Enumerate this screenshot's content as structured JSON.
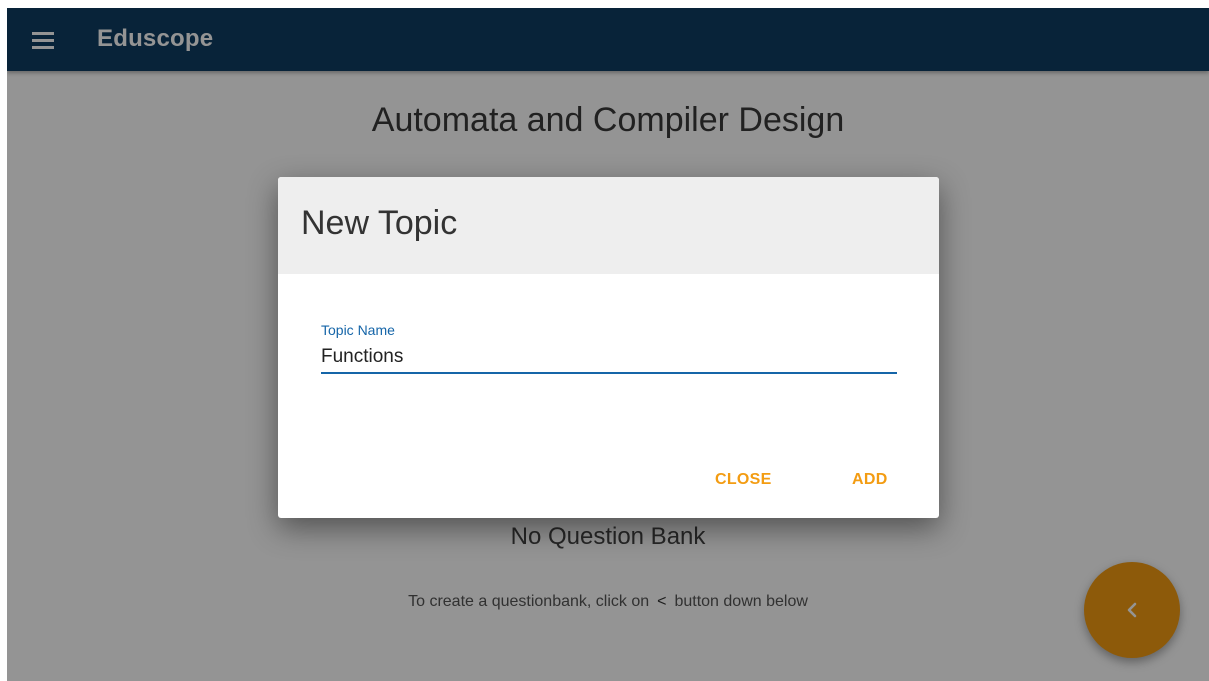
{
  "appbar": {
    "title": "Eduscope"
  },
  "page": {
    "title": "Automata and Compiler Design",
    "empty_title": "No Question Bank",
    "hint_before": "To create a questionbank, click on",
    "hint_symbol": "<",
    "hint_after": "button down below"
  },
  "fab": {
    "icon": "chevron-left-icon"
  },
  "dialog": {
    "title": "New Topic",
    "field_label": "Topic Name",
    "field_value": "Functions",
    "close_label": "CLOSE",
    "add_label": "ADD"
  },
  "colors": {
    "appbar": "#0f3d63",
    "accent": "#f39c12",
    "input_focus": "#1565a8"
  }
}
